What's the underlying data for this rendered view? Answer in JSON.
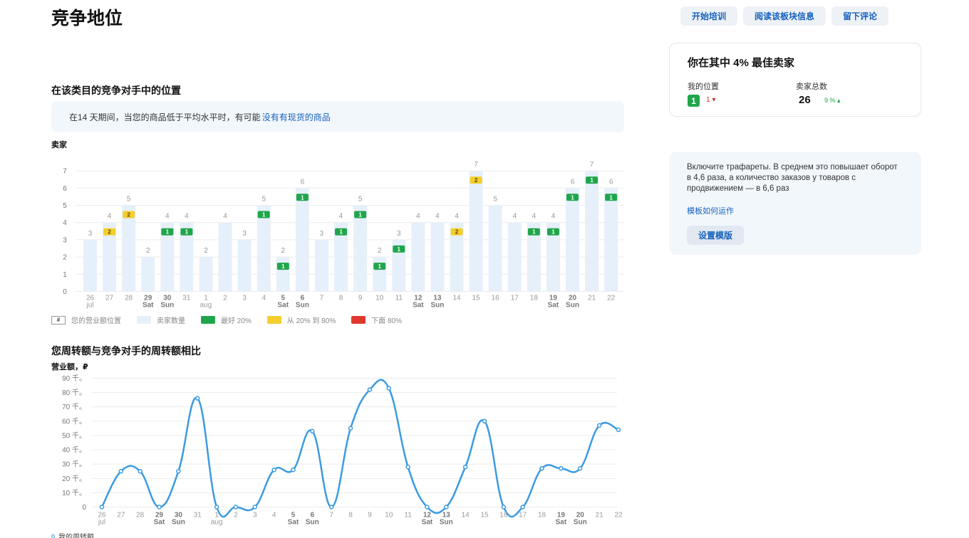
{
  "header": {
    "title": "竞争地位",
    "buttons": [
      "开始培训",
      "阅读该板块信息",
      "留下评论"
    ]
  },
  "position_section": {
    "title": "在该类目的竞争对手中的位置",
    "notice_text": "在14 天期间，当您的商品低于平均水平时，有可能",
    "notice_link": "没有有现货的商品",
    "axis_caption": "卖家"
  },
  "legend": {
    "hash_symbol": "#",
    "items": [
      {
        "label": "您的营业额位置",
        "color": ""
      },
      {
        "label": "卖家数量",
        "color": "#e6f0fb"
      },
      {
        "label": "最好 20%",
        "color": "#1fa64a"
      },
      {
        "label": "从 20% 到 80%",
        "color": "#f5cd2e"
      },
      {
        "label": "下面 80%",
        "color": "#e03a2e"
      }
    ]
  },
  "revenue_section": {
    "title": "您周转额与竞争对手的周转额相比",
    "axis_caption": "营业额，₽",
    "series_legend": "我的周转额"
  },
  "stats_card": {
    "title": "你在其中 4% 最佳卖家",
    "my_position_label": "我的位置",
    "my_position_value": "1",
    "my_position_change": "1",
    "total_sellers_label": "卖家总数",
    "total_sellers_value": "26",
    "total_sellers_change": "9 %"
  },
  "promo": {
    "text": "Включите трафареты. В среднем это повышает оборот в 4,6 раза, а количество заказов у товаров с продвижением — в 6,6 раз",
    "link": "模板如何运作",
    "button": "设置模版"
  },
  "chart_data": [
    {
      "type": "bar",
      "categories": [
        "26",
        "27",
        "28",
        "29",
        "30",
        "31",
        "1",
        "2",
        "3",
        "4",
        "5",
        "6",
        "7",
        "8",
        "9",
        "10",
        "11",
        "12",
        "13",
        "14",
        "15",
        "16",
        "17",
        "18",
        "19",
        "20",
        "21",
        "22"
      ],
      "sublabels": [
        "jul",
        "",
        "",
        "Sat",
        "Sun",
        "",
        "aug",
        "",
        "",
        "",
        "Sat",
        "Sun",
        "",
        "",
        "",
        "",
        "",
        "Sat",
        "Sun",
        "",
        "",
        "",
        "",
        "",
        "Sat",
        "Sun",
        "",
        ""
      ],
      "bold_categories": [
        "29",
        "30",
        "5",
        "6",
        "12",
        "13",
        "19",
        "20"
      ],
      "values": [
        3,
        4,
        5,
        2,
        4,
        4,
        2,
        4,
        3,
        5,
        2,
        6,
        3,
        4,
        5,
        2,
        3,
        4,
        4,
        4,
        7,
        5,
        4,
        4,
        4,
        6,
        7,
        6
      ],
      "position_badges": [
        null,
        2,
        2,
        null,
        1,
        1,
        null,
        null,
        null,
        1,
        1,
        1,
        null,
        1,
        1,
        1,
        1,
        null,
        null,
        2,
        2,
        null,
        null,
        1,
        1,
        1,
        1,
        1
      ],
      "ylim": [
        0,
        7
      ],
      "yticks": [
        0,
        1,
        2,
        3,
        4,
        5,
        6,
        7
      ],
      "bar_color": "#e6f0fb",
      "colors": {
        "top": "#1fa64a",
        "mid": "#f5cd2e",
        "low": "#e03a2e"
      }
    },
    {
      "type": "line",
      "categories": [
        "26",
        "27",
        "28",
        "29",
        "30",
        "31",
        "1",
        "2",
        "3",
        "4",
        "5",
        "6",
        "7",
        "8",
        "9",
        "10",
        "11",
        "12",
        "13",
        "14",
        "15",
        "16",
        "17",
        "18",
        "19",
        "20",
        "21",
        "22"
      ],
      "sublabels": [
        "jul",
        "",
        "",
        "Sat",
        "Sun",
        "",
        "aug",
        "",
        "",
        "",
        "Sat",
        "Sun",
        "",
        "",
        "",
        "",
        "",
        "Sat",
        "Sun",
        "",
        "",
        "",
        "",
        "",
        "Sat",
        "Sun",
        "",
        ""
      ],
      "bold_categories": [
        "29",
        "30",
        "5",
        "6",
        "12",
        "13",
        "19",
        "20"
      ],
      "series": [
        {
          "name": "我的周转额",
          "values": [
            0,
            25000,
            25000,
            0,
            25000,
            76000,
            0,
            0,
            0,
            26000,
            26000,
            53000,
            0,
            55000,
            82000,
            83000,
            28000,
            0,
            0,
            28000,
            60000,
            0,
            0,
            27000,
            27000,
            27000,
            57000,
            54000
          ]
        }
      ],
      "ylim": [
        0,
        90000
      ],
      "ytick_labels": [
        "0",
        "10 千。",
        "20 千。",
        "30 千。",
        "40 千。",
        "50 千。",
        "60 千。",
        "70 千。",
        "80 千。",
        "90 千。"
      ],
      "line_color": "#3b9be2"
    }
  ]
}
